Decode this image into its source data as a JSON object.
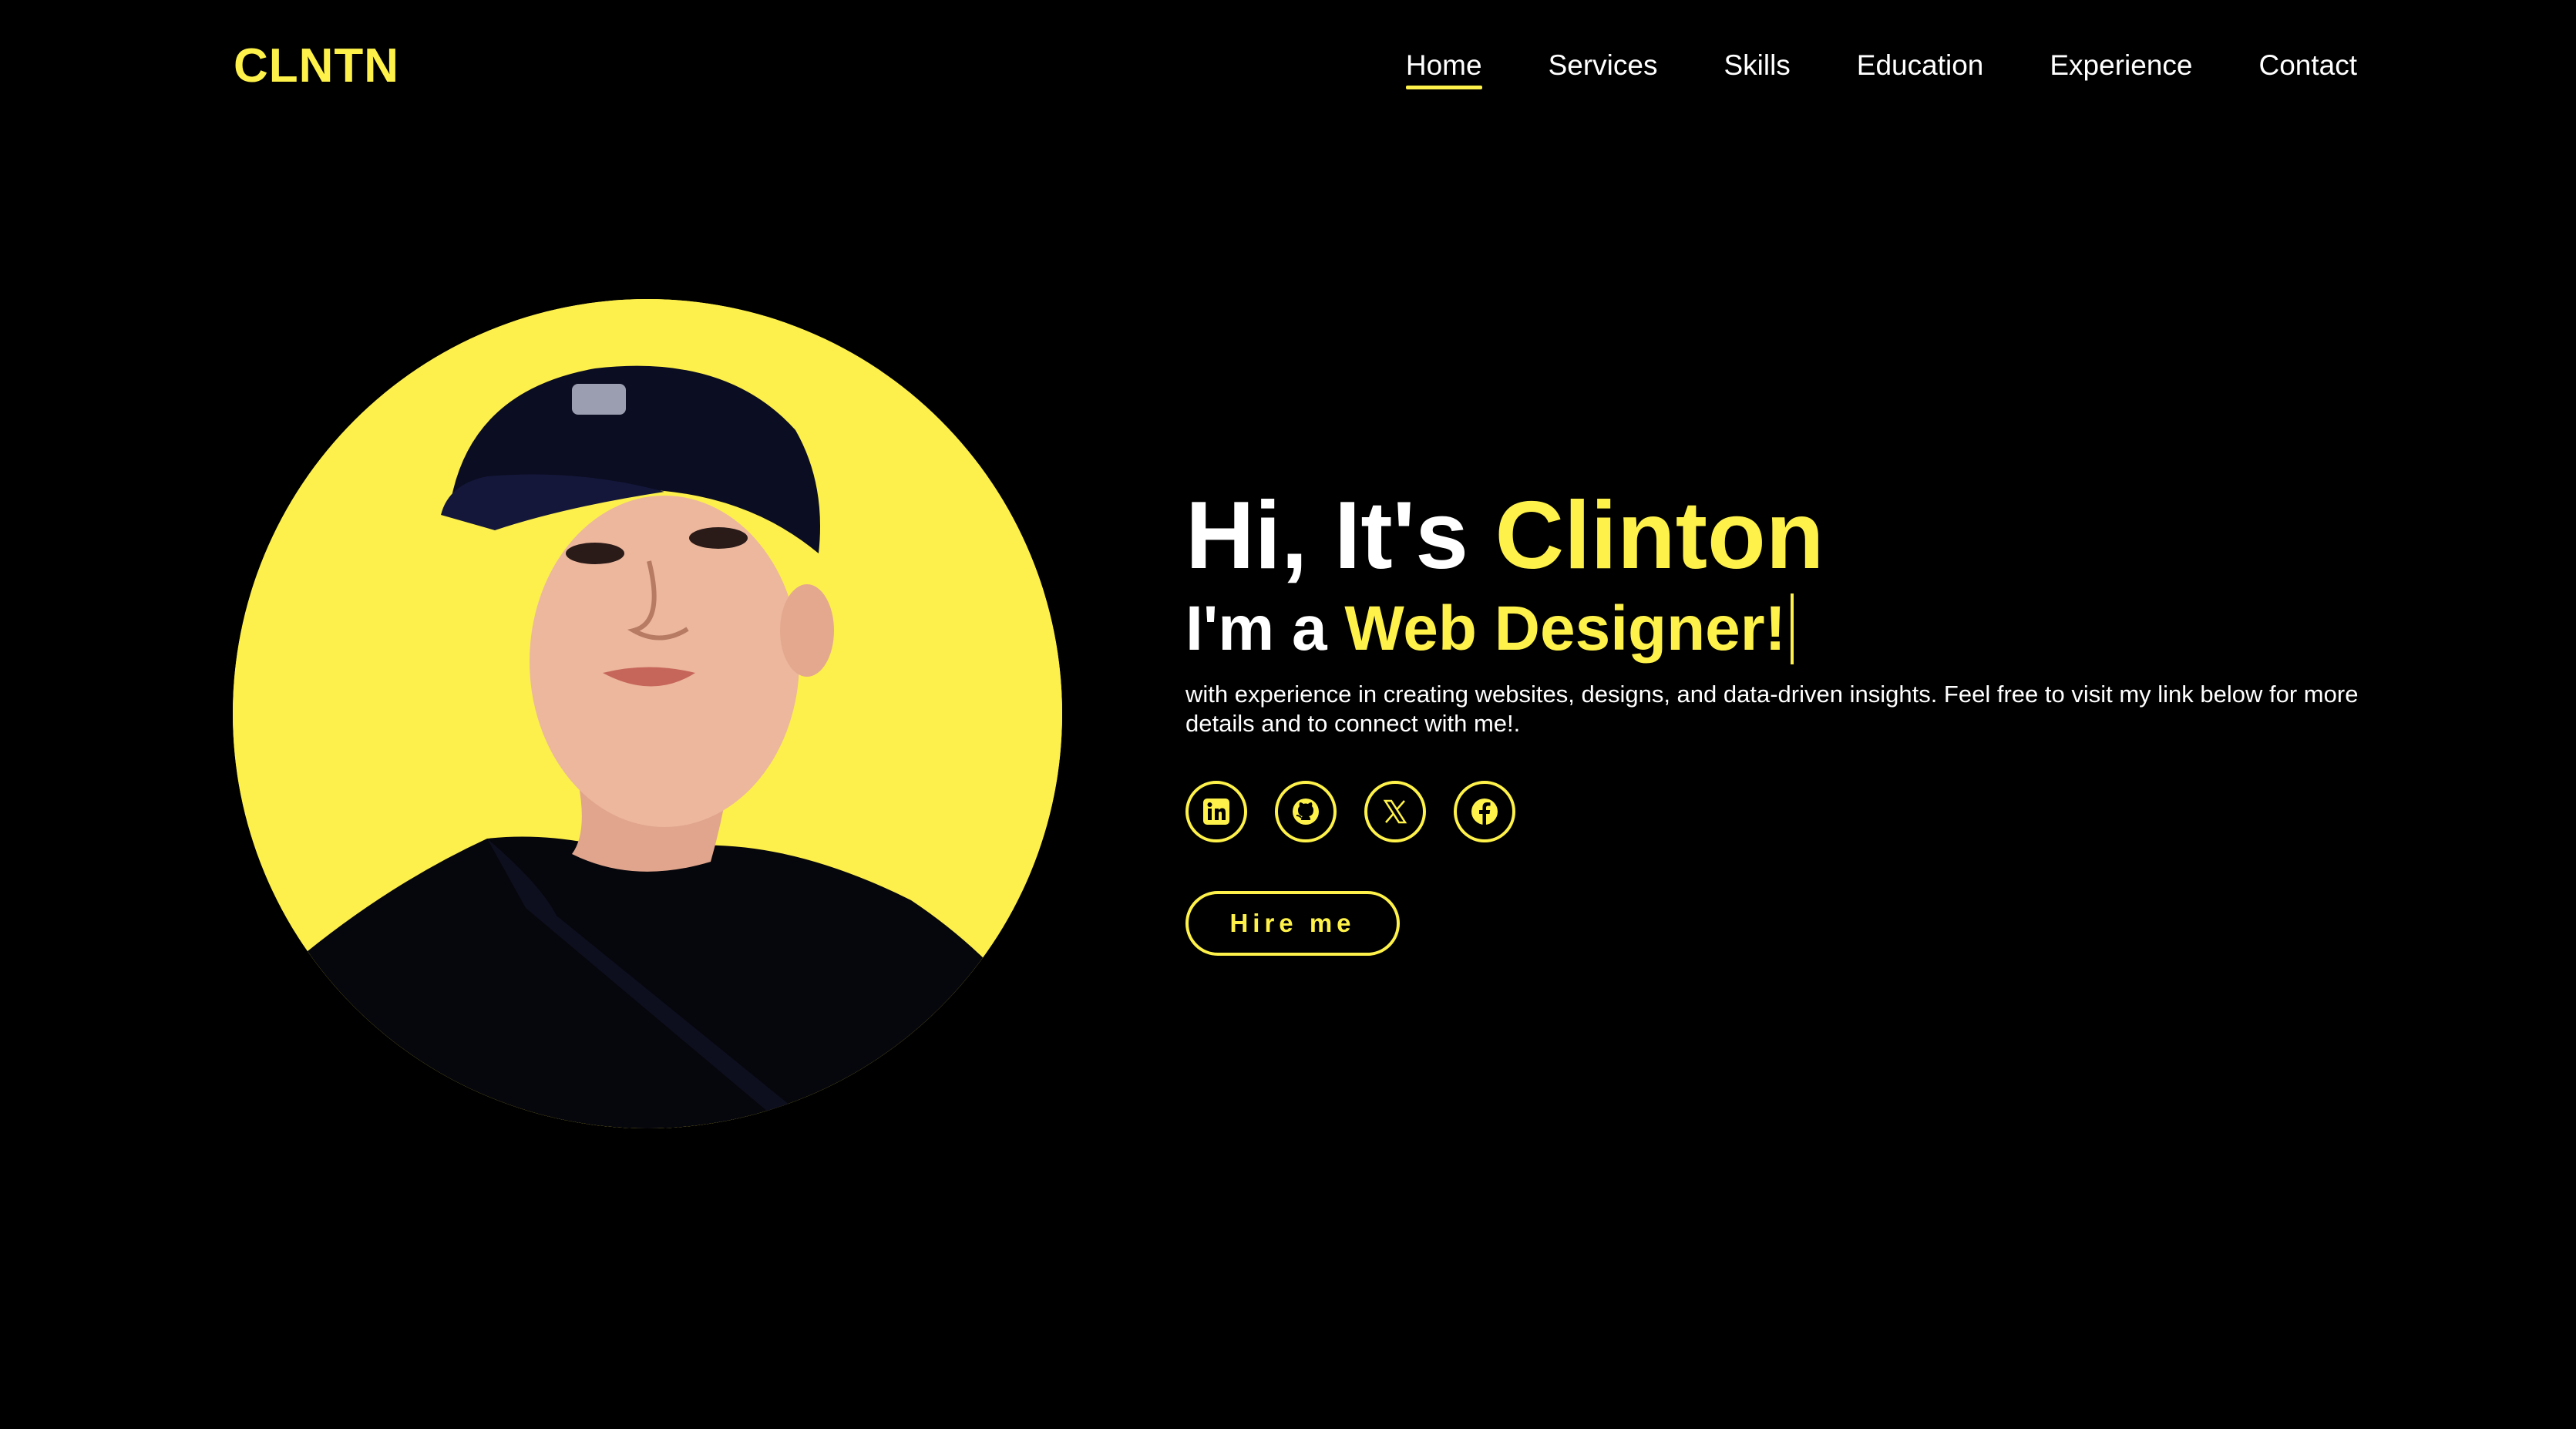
{
  "brand": {
    "logo": "CLNTN",
    "accent_color": "#fef24a",
    "background_color": "#000000"
  },
  "nav": {
    "items": [
      {
        "label": "Home",
        "active": true
      },
      {
        "label": "Services",
        "active": false
      },
      {
        "label": "Skills",
        "active": false
      },
      {
        "label": "Education",
        "active": false
      },
      {
        "label": "Experience",
        "active": false
      },
      {
        "label": "Contact",
        "active": false
      }
    ]
  },
  "hero": {
    "greeting_prefix": "Hi, It's ",
    "greeting_name": "Clinton",
    "role_prefix": "I'm a ",
    "role_title": "Web Designer!",
    "description": "with experience in creating websites, designs, and data-driven insights. Feel free to visit my link below for more details and to connect with me!.",
    "portrait_icon": "profile-photo",
    "socials": [
      {
        "name": "linkedin",
        "icon": "linkedin-icon"
      },
      {
        "name": "github",
        "icon": "github-icon"
      },
      {
        "name": "x",
        "icon": "x-icon"
      },
      {
        "name": "facebook",
        "icon": "facebook-icon"
      }
    ],
    "cta_label": "Hire me"
  }
}
